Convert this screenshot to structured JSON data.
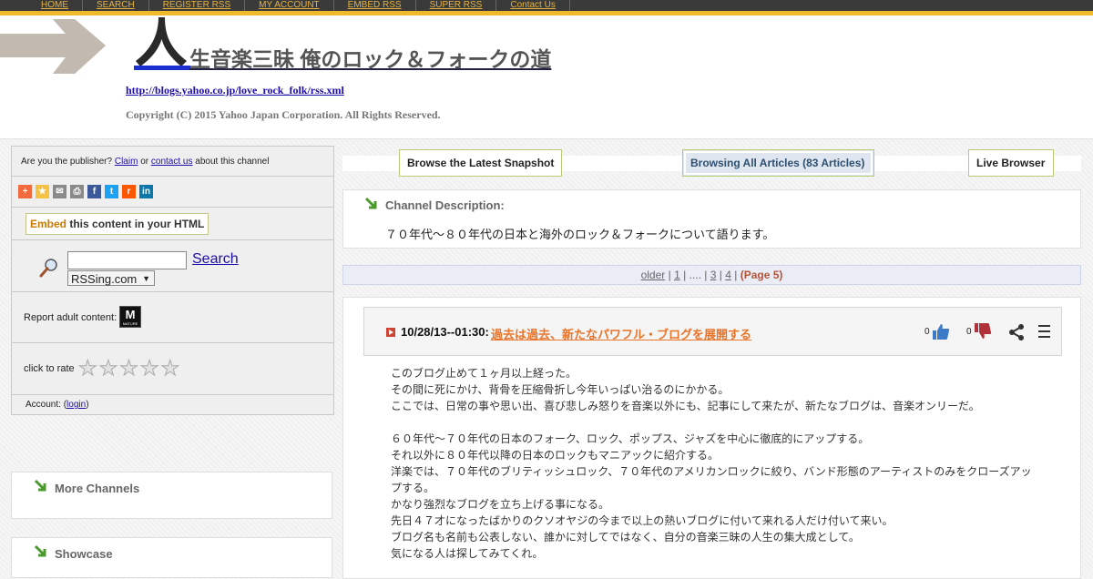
{
  "nav": {
    "items": [
      "HOME",
      "SEARCH",
      "REGISTER RSS",
      "MY ACCOUNT",
      "EMBED RSS",
      "SUPER RSS",
      "Contact Us"
    ]
  },
  "header": {
    "title": "生音楽三昧 俺のロック＆フォークの道",
    "feed_url": "http://blogs.yahoo.co.jp/love_rock_folk/rss.xml",
    "copyright": "Copyright (C) 2015 Yahoo Japan Corporation. All Rights Reserved."
  },
  "sidebar": {
    "claim": {
      "prefix": "Are you the publisher?",
      "claim_link": "Claim",
      "or": "or",
      "contact_link": "contact us",
      "suffix": "about this channel"
    },
    "share_icons": [
      "add-icon",
      "favorite-star-icon",
      "email-icon",
      "print-icon",
      "facebook-icon",
      "twitter-icon",
      "reddit-icon",
      "linkedin-icon"
    ],
    "embed": {
      "highlight": "Embed",
      "rest": "this content in your HTML"
    },
    "search": {
      "button": "Search",
      "input_value": "",
      "select_value": "RSSing.com"
    },
    "adult": {
      "label": "Report adult content:",
      "badge": "M",
      "badge_small": "MATURE"
    },
    "rate": {
      "label": "click to rate",
      "stars": 5
    },
    "account": {
      "label": "Account:",
      "open": "(",
      "login": "login",
      "close": ")"
    }
  },
  "side_boxes": {
    "more_channels": "More Channels",
    "showcase": "Showcase"
  },
  "tabs": {
    "snapshot": "Browse the Latest Snapshot",
    "all_articles": "Browsing All Articles (83 Articles)",
    "live": "Live Browser"
  },
  "channel": {
    "heading": "Channel Description:",
    "description": "７０年代～８０年代の日本と海外のロック＆フォークについて語ります。"
  },
  "pager": {
    "older": "older",
    "sep": "|",
    "p1": "1",
    "dots": "....",
    "p3": "3",
    "p4": "4",
    "current": "(Page 5)"
  },
  "article": {
    "date": "10/28/13--01:30:",
    "title": "過去は過去、新たなパワフル・ブログを展開する",
    "likes": "0",
    "dislikes": "0",
    "body": [
      "このブログ止めて１ヶ月以上経った。",
      "その間に死にかけ、背骨を圧縮骨折し今年いっぱい治るのにかかる。",
      "ここでは、日常の事や思い出、喜び悲しみ怒りを音楽以外にも、記事にして来たが、新たなブログは、音楽オンリーだ。",
      "",
      "６０年代～７０年代の日本のフォーク、ロック、ポップス、ジャズを中心に徹底的にアップする。",
      "それ以外に８０年代以降の日本のロックもマニアックに紹介する。",
      "洋楽では、７０年代のブリティッシュロック、７０年代のアメリカンロックに絞り、バンド形態のアーティストのみをクローズアップする。",
      "かなり強烈なブログを立ち上げる事になる。",
      "先日４７才になったばかりのクソオヤジの今まで以上の熱いブログに付いて来れる人だけ付いて来い。",
      "ブログ名も名前も公表しない、誰かに対してではなく、自分の音楽三昧の人生の集大成として。",
      "気になる人は探してみてくれ。"
    ]
  },
  "colors": {
    "nav_bg": "#3a3a3a",
    "nav_gold": "#f0b92b",
    "link": "#1a0dab",
    "article_title": "#e8742a",
    "green_arrow": "#4a9a2c"
  }
}
